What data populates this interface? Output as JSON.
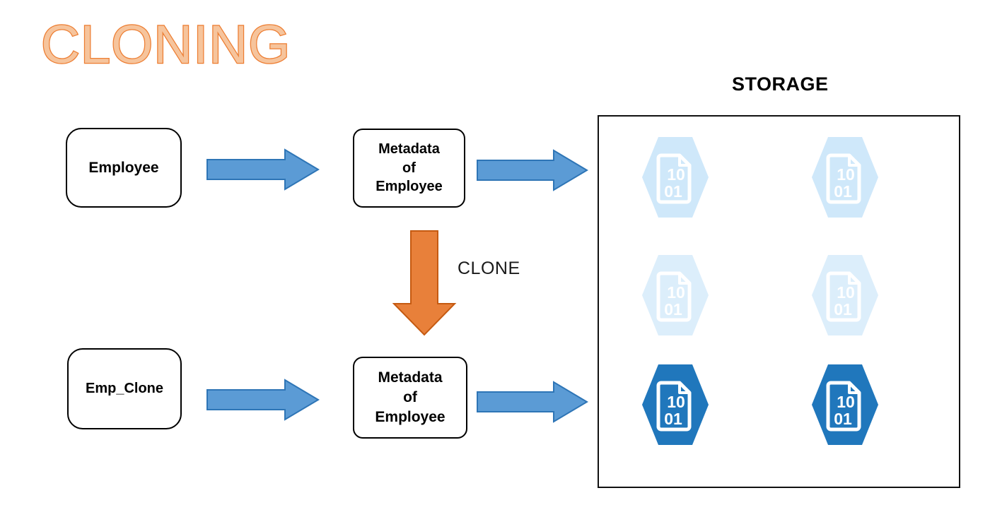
{
  "title": "CLONING",
  "theme": {
    "title_fill": "#F6C49C",
    "title_stroke": "#ED7D31",
    "arrow_blue_fill": "#5B9BD5",
    "arrow_blue_stroke": "#2E75B6",
    "arrow_orange_fill": "#E8803A",
    "arrow_orange_stroke": "#C55A11",
    "hex_dark": "#2077BC",
    "hex_light": "#CFE8FA",
    "hex_lighter": "#DCEEFB",
    "box_border": "#000000",
    "panel_border": "#111111"
  },
  "flow": {
    "source_table": "Employee",
    "clone_table": "Emp_Clone",
    "metadata_top": "Metadata\nof\nEmployee",
    "metadata_top_lines": [
      "Metadata",
      "of",
      "Employee"
    ],
    "metadata_bottom": "Metadata\nof\nEmployee",
    "metadata_bottom_lines": [
      "Metadata",
      "of",
      "Employee"
    ],
    "clone_label": "CLONE"
  },
  "storage": {
    "heading": "STORAGE",
    "micro_partitions": [
      {
        "row": 1,
        "col": 1,
        "shade": "light",
        "top_digits": "10",
        "bottom_digits": "01"
      },
      {
        "row": 1,
        "col": 2,
        "shade": "light",
        "top_digits": "10",
        "bottom_digits": "01"
      },
      {
        "row": 2,
        "col": 1,
        "shade": "lighter",
        "top_digits": "10",
        "bottom_digits": "01"
      },
      {
        "row": 2,
        "col": 2,
        "shade": "lighter",
        "top_digits": "10",
        "bottom_digits": "01"
      },
      {
        "row": 3,
        "col": 1,
        "shade": "dark",
        "top_digits": "10",
        "bottom_digits": "01"
      },
      {
        "row": 3,
        "col": 2,
        "shade": "dark",
        "top_digits": "10",
        "bottom_digits": "01"
      }
    ]
  },
  "icons": {
    "hexagon_data_file": "hexagon-binary-file-icon",
    "arrow_right": "arrow-right-icon",
    "arrow_down": "arrow-down-icon"
  }
}
